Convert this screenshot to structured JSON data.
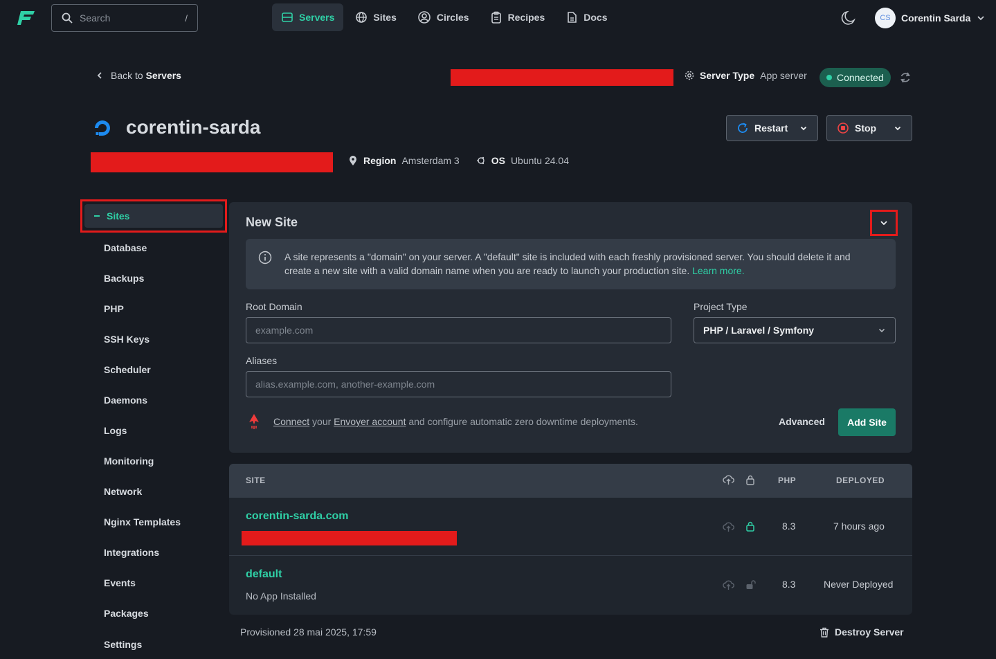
{
  "topnav": {
    "search_placeholder": "Search",
    "search_shortcut": "/",
    "items": [
      {
        "label": "Servers",
        "icon": "server-icon",
        "active": true
      },
      {
        "label": "Sites",
        "icon": "globe-icon"
      },
      {
        "label": "Circles",
        "icon": "circles-icon"
      },
      {
        "label": "Recipes",
        "icon": "clipboard-icon"
      },
      {
        "label": "Docs",
        "icon": "document-icon"
      }
    ],
    "user_initials": "CS",
    "user_name": "Corentin Sarda"
  },
  "header": {
    "back_prefix": "Back to",
    "back_target": "Servers",
    "server_type_label": "Server Type",
    "server_type_value": "App server",
    "status": "Connected",
    "server_name": "corentin-sarda",
    "region_label": "Region",
    "region_value": "Amsterdam 3",
    "os_label": "OS",
    "os_value": "Ubuntu 24.04",
    "restart_label": "Restart",
    "stop_label": "Stop"
  },
  "sidebar": {
    "items": [
      "Sites",
      "Database",
      "Backups",
      "PHP",
      "SSH Keys",
      "Scheduler",
      "Daemons",
      "Logs",
      "Monitoring",
      "Network",
      "Nginx Templates",
      "Integrations",
      "Events",
      "Packages",
      "Settings"
    ]
  },
  "new_site": {
    "title": "New Site",
    "info_text": "A site represents a \"domain\" on your server. A \"default\" site is included with each freshly provisioned server. You should delete it and create a new site with a valid domain name when you are ready to launch your production site.",
    "learn_more": "Learn more.",
    "root_domain_label": "Root Domain",
    "root_domain_placeholder": "example.com",
    "project_type_label": "Project Type",
    "project_type_value": "PHP / Laravel / Symfony",
    "aliases_label": "Aliases",
    "aliases_placeholder": "alias.example.com, another-example.com",
    "envoy_connect": "Connect",
    "envoy_your": "your",
    "envoy_account": "Envoyer account",
    "envoy_rest": "and configure automatic zero downtime deployments.",
    "advanced_label": "Advanced",
    "add_site_label": "Add Site"
  },
  "sites_table": {
    "headers": {
      "site": "SITE",
      "php": "PHP",
      "deployed": "DEPLOYED"
    },
    "rows": [
      {
        "name": "corentin-sarda.com",
        "sub": "",
        "php": "8.3",
        "deployed": "7 hours ago",
        "locked": true
      },
      {
        "name": "default",
        "sub": "No App Installed",
        "php": "8.3",
        "deployed": "Never Deployed",
        "locked": false
      }
    ]
  },
  "footer": {
    "provisioned": "Provisioned 28 mai 2025, 17:59",
    "destroy_label": "Destroy Server"
  },
  "colors": {
    "accent": "#2fd0a6",
    "background": "#171b22",
    "panel": "#252b34",
    "redaction": "#e31b1b"
  }
}
